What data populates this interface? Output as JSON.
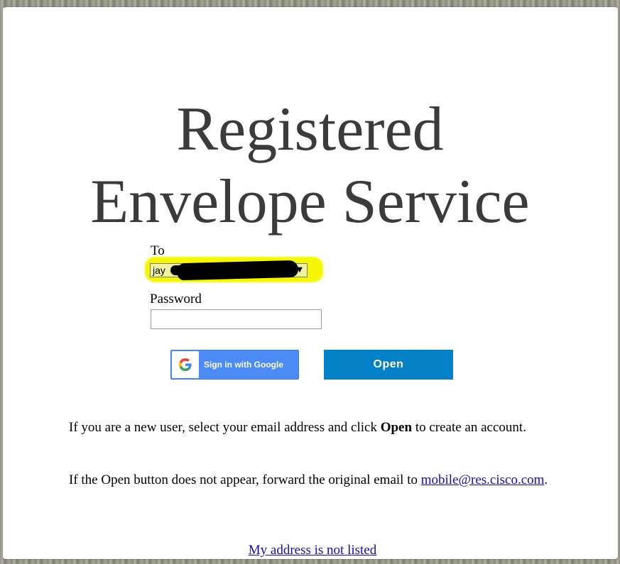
{
  "page": {
    "title_line1": "Registered",
    "title_line2": "Envelope Service"
  },
  "form": {
    "to_label": "To",
    "to_value": "jay",
    "password_label": "Password",
    "password_value": ""
  },
  "buttons": {
    "google_label": "Sign in with Google",
    "open_label": "Open"
  },
  "info": {
    "para1_before": "If you are a new user, select your email address and click ",
    "para1_bold": "Open",
    "para1_after": " to create an account.",
    "para2_before": "If the Open button does not appear, forward the original email to ",
    "para2_link": "mobile@res.cisco.com",
    "para2_after": "."
  },
  "footer": {
    "address_link": "My address is not listed"
  },
  "colors": {
    "open_button": "#0380c6",
    "google_button": "#4c8bf5",
    "highlight": "#f4f700",
    "link": "#1a0dab"
  },
  "icons": [
    "google-icon",
    "dropdown-arrow-icon"
  ]
}
